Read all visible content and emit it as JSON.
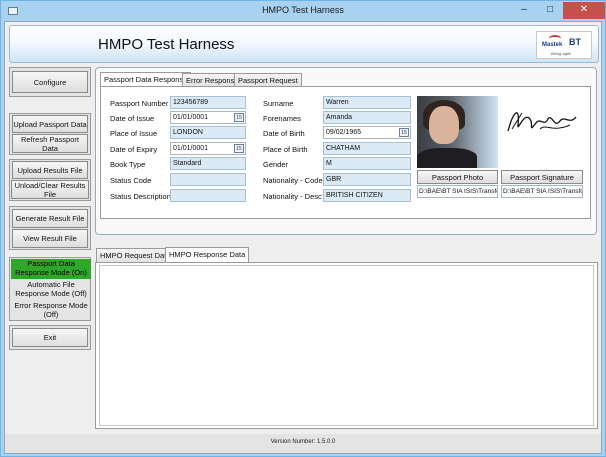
{
  "window": {
    "title": "HMPO Test Harness"
  },
  "header": {
    "title": "HMPO Test Harness",
    "logo": {
      "brand": "Mastek",
      "bt": "BT",
      "tagline": "Being agile"
    }
  },
  "sidebar": {
    "configure": "Configure",
    "upload_passport": "Upload Passport Data",
    "refresh_passport": "Refresh Passport Data",
    "upload_results": "Upload Results File",
    "unload_results": "Unload/Clear Results File",
    "generate_result": "Generate Result File",
    "view_result": "View Result File",
    "modes": [
      {
        "label": "Passport Data Response Mode (On)",
        "active": true
      },
      {
        "label": "Automatic File Response Mode (Off)",
        "active": false
      },
      {
        "label": "Error Response Mode (Off)",
        "active": false
      }
    ],
    "exit": "Exit"
  },
  "top_tabs": [
    "Passport Data Response",
    "Error Response",
    "Passport Request"
  ],
  "passport": {
    "labels": {
      "number": "Passport Number",
      "date_issue": "Date of Issue",
      "place_issue": "Place of Issue",
      "date_expiry": "Date of Expiry",
      "book_type": "Book Type",
      "status_code": "Status Code",
      "status_desc": "Status Description",
      "surname": "Surname",
      "forenames": "Forenames",
      "dob": "Date of Birth",
      "pob": "Place of Birth",
      "gender": "Gender",
      "nat_code": "Nationality - Code",
      "nat_desc": "Nationality - Desc"
    },
    "values": {
      "number": "123456789",
      "date_issue": "01/01/0001",
      "place_issue": "LONDON",
      "date_expiry": "01/01/0001",
      "book_type": "Standard",
      "status_code": "",
      "status_desc": "",
      "surname": "Warren",
      "forenames": "Amanda",
      "dob": "09/02/1965",
      "pob": "CHATHAM",
      "gender": "M",
      "nat_code": "GBR",
      "nat_desc": "BRITISH CITIZEN"
    },
    "calendar_glyph": "15",
    "photo_button": "Passport Photo",
    "signature_button": "Passport Signature",
    "photo_path": "D:\\BAE\\BT SIA ISIS\\Transfo",
    "signature_path": "D:\\BAE\\BT SIA ISIS\\Transfo"
  },
  "bottom_tabs": [
    "HMPO Request Data",
    "HMPO Response Data"
  ],
  "status": {
    "version": "Version Number: 1.5.0.0"
  },
  "colors": {
    "mode_on": "#2fa829",
    "title_bar": "#a8d2f0",
    "field_bg": "#dceaf6"
  }
}
